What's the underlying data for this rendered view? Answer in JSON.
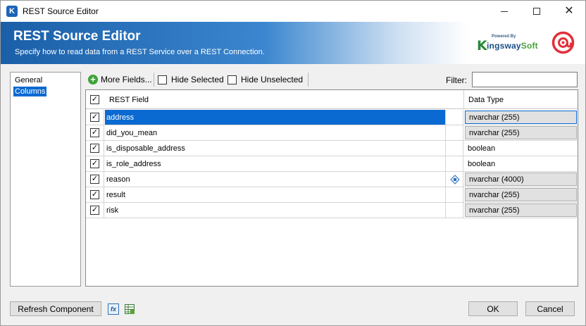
{
  "window": {
    "title": "REST Source Editor",
    "app_icon_letter": "K"
  },
  "banner": {
    "title": "REST Source Editor",
    "subtitle": "Specify how to read data from a REST Service over a REST Connection.",
    "logo_powered": "Powered By",
    "logo_k": "K",
    "logo_name_main": "ingsway",
    "logo_name_soft": "Soft"
  },
  "nav": {
    "items": [
      {
        "label": "General",
        "selected": false
      },
      {
        "label": "Columns",
        "selected": true
      }
    ]
  },
  "toolbar": {
    "more_fields_label": "More Fields...",
    "hide_selected_label": "Hide Selected",
    "hide_unselected_label": "Hide Unselected",
    "filter_label": "Filter:",
    "filter_value": ""
  },
  "grid": {
    "columns": {
      "field": "REST Field",
      "type": "Data Type"
    },
    "rows": [
      {
        "checked": true,
        "field": "address",
        "type": "nvarchar (255)",
        "editable_type": true,
        "has_icon": false
      },
      {
        "checked": true,
        "field": "did_you_mean",
        "type": "nvarchar (255)",
        "editable_type": true,
        "has_icon": false
      },
      {
        "checked": true,
        "field": "is_disposable_address",
        "type": "boolean",
        "editable_type": false,
        "has_icon": false
      },
      {
        "checked": true,
        "field": "is_role_address",
        "type": "boolean",
        "editable_type": false,
        "has_icon": false
      },
      {
        "checked": true,
        "field": "reason",
        "type": "nvarchar (4000)",
        "editable_type": true,
        "has_icon": true
      },
      {
        "checked": true,
        "field": "result",
        "type": "nvarchar (255)",
        "editable_type": true,
        "has_icon": false
      },
      {
        "checked": true,
        "field": "risk",
        "type": "nvarchar (255)",
        "editable_type": true,
        "has_icon": false
      }
    ]
  },
  "footer": {
    "refresh_label": "Refresh Component",
    "fx_label": "fx",
    "ok_label": "OK",
    "cancel_label": "Cancel"
  },
  "colors": {
    "selection": "#0a6ad1",
    "banner_start": "#1a5fa8",
    "badge_red": "#e0303a"
  }
}
